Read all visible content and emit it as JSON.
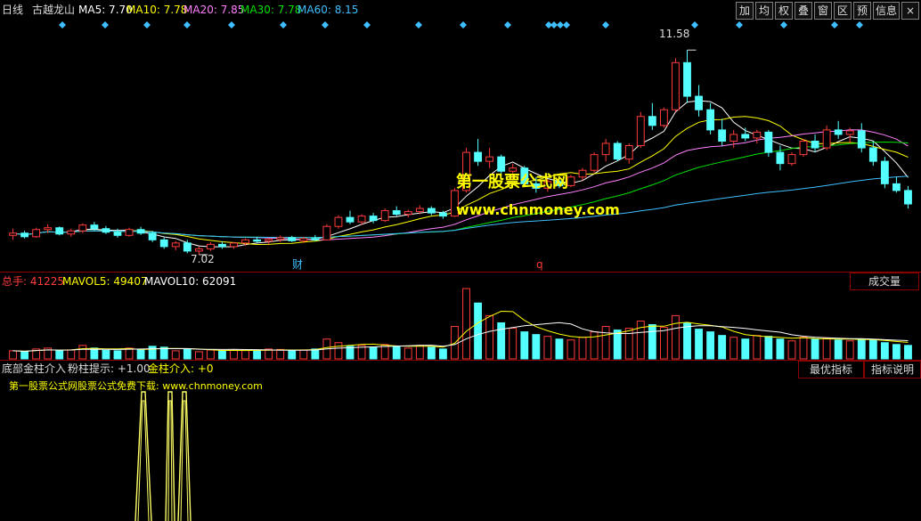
{
  "header": {
    "period": "日线",
    "stock_name": "古越龙山",
    "ma5": "MA5: 7.70",
    "ma10": "MA10: 7.78",
    "ma20": "MA20: 7.85",
    "ma30": "MA30: 7.78",
    "ma60": "MA60: 8.15"
  },
  "toolbar": {
    "buttons": [
      "加",
      "均",
      "权",
      "叠",
      "窗",
      "区",
      "预",
      "信息"
    ],
    "close": "×"
  },
  "main_chart": {
    "watermark_cn": "第一股票公式网",
    "watermark_url": "www.chnmoney.com",
    "high_label": "11.58",
    "low_label": "7.02",
    "marker_cai": "财",
    "marker_q": "q"
  },
  "volume_panel": {
    "total": "总手: 41225",
    "mavol5": "MAVOL5: 49407",
    "mavol10": "MAVOL10: 62091",
    "tab": "成交量"
  },
  "indicator_panel": {
    "title": "底部金柱介入",
    "hint": "粉柱提示: +1.00",
    "gold": "金柱介入: +0",
    "download": "第一股票公式网股票公式免费下载: www.chnmoney.com",
    "tab_best": "最优指标",
    "tab_help": "指标说明"
  },
  "colors": {
    "up": "#ff3b3b",
    "down": "#54ffff",
    "ma5": "#ffffff",
    "ma10": "#ffff00",
    "ma20": "#ff80ff",
    "ma30": "#00e000",
    "ma60": "#3fbfff",
    "grid_line": "#8b0000",
    "signal": "#ffff66"
  },
  "chart_data": {
    "type": "candlestick",
    "price_range": [
      6.9,
      12.1
    ],
    "high": 11.58,
    "low": 7.02,
    "candles": [
      [
        7.45,
        7.6,
        7.35,
        7.5
      ],
      [
        7.5,
        7.55,
        7.38,
        7.42
      ],
      [
        7.42,
        7.62,
        7.4,
        7.58
      ],
      [
        7.58,
        7.7,
        7.5,
        7.62
      ],
      [
        7.62,
        7.65,
        7.45,
        7.48
      ],
      [
        7.48,
        7.6,
        7.42,
        7.55
      ],
      [
        7.55,
        7.72,
        7.5,
        7.68
      ],
      [
        7.68,
        7.75,
        7.55,
        7.6
      ],
      [
        7.6,
        7.66,
        7.48,
        7.52
      ],
      [
        7.52,
        7.6,
        7.4,
        7.45
      ],
      [
        7.45,
        7.62,
        7.42,
        7.58
      ],
      [
        7.58,
        7.64,
        7.46,
        7.5
      ],
      [
        7.5,
        7.55,
        7.3,
        7.35
      ],
      [
        7.35,
        7.4,
        7.15,
        7.2
      ],
      [
        7.2,
        7.32,
        7.12,
        7.28
      ],
      [
        7.28,
        7.35,
        7.05,
        7.1
      ],
      [
        7.1,
        7.2,
        7.02,
        7.15
      ],
      [
        7.15,
        7.3,
        7.1,
        7.25
      ],
      [
        7.25,
        7.32,
        7.15,
        7.2
      ],
      [
        7.2,
        7.3,
        7.15,
        7.28
      ],
      [
        7.28,
        7.38,
        7.22,
        7.35
      ],
      [
        7.35,
        7.42,
        7.28,
        7.32
      ],
      [
        7.32,
        7.4,
        7.25,
        7.36
      ],
      [
        7.36,
        7.45,
        7.3,
        7.4
      ],
      [
        7.4,
        7.44,
        7.3,
        7.33
      ],
      [
        7.33,
        7.42,
        7.28,
        7.38
      ],
      [
        7.38,
        7.46,
        7.32,
        7.35
      ],
      [
        7.35,
        7.7,
        7.34,
        7.65
      ],
      [
        7.65,
        7.9,
        7.6,
        7.85
      ],
      [
        7.85,
        8.0,
        7.7,
        7.75
      ],
      [
        7.75,
        7.92,
        7.68,
        7.88
      ],
      [
        7.88,
        7.95,
        7.72,
        7.78
      ],
      [
        7.78,
        8.05,
        7.75,
        8.0
      ],
      [
        8.0,
        8.1,
        7.88,
        7.92
      ],
      [
        7.92,
        8.02,
        7.85,
        7.98
      ],
      [
        7.98,
        8.12,
        7.92,
        8.05
      ],
      [
        8.05,
        8.1,
        7.9,
        7.95
      ],
      [
        7.95,
        8.0,
        7.82,
        7.88
      ],
      [
        7.88,
        8.5,
        7.86,
        8.45
      ],
      [
        8.45,
        9.4,
        8.4,
        9.3
      ],
      [
        9.3,
        9.6,
        9.0,
        9.1
      ],
      [
        9.1,
        9.4,
        8.95,
        9.2
      ],
      [
        9.2,
        9.25,
        8.8,
        8.88
      ],
      [
        8.88,
        9.05,
        8.7,
        8.95
      ],
      [
        8.95,
        9.0,
        8.55,
        8.6
      ],
      [
        8.6,
        8.75,
        8.4,
        8.5
      ],
      [
        8.5,
        8.7,
        8.42,
        8.65
      ],
      [
        8.65,
        8.72,
        8.5,
        8.56
      ],
      [
        8.56,
        8.8,
        8.52,
        8.75
      ],
      [
        8.75,
        8.95,
        8.68,
        8.9
      ],
      [
        8.9,
        9.3,
        8.85,
        9.25
      ],
      [
        9.25,
        9.6,
        9.1,
        9.5
      ],
      [
        9.5,
        9.55,
        9.1,
        9.15
      ],
      [
        9.15,
        9.5,
        9.05,
        9.45
      ],
      [
        9.45,
        10.2,
        9.4,
        10.1
      ],
      [
        10.1,
        10.4,
        9.8,
        9.9
      ],
      [
        9.9,
        10.3,
        9.85,
        10.25
      ],
      [
        10.25,
        11.4,
        10.2,
        11.3
      ],
      [
        11.3,
        11.58,
        10.4,
        10.55
      ],
      [
        10.55,
        10.8,
        10.1,
        10.25
      ],
      [
        10.25,
        10.4,
        9.7,
        9.8
      ],
      [
        9.8,
        10.05,
        9.45,
        9.55
      ],
      [
        9.55,
        9.8,
        9.4,
        9.7
      ],
      [
        9.7,
        9.85,
        9.55,
        9.62
      ],
      [
        9.62,
        9.8,
        9.5,
        9.75
      ],
      [
        9.75,
        9.8,
        9.2,
        9.3
      ],
      [
        9.3,
        9.45,
        8.9,
        9.05
      ],
      [
        9.05,
        9.3,
        9.0,
        9.25
      ],
      [
        9.25,
        9.6,
        9.2,
        9.55
      ],
      [
        9.55,
        9.7,
        9.3,
        9.4
      ],
      [
        9.4,
        9.9,
        9.35,
        9.8
      ],
      [
        9.8,
        10.0,
        9.6,
        9.7
      ],
      [
        9.7,
        9.85,
        9.5,
        9.78
      ],
      [
        9.78,
        9.95,
        9.3,
        9.4
      ],
      [
        9.4,
        9.55,
        9.0,
        9.1
      ],
      [
        9.1,
        9.2,
        8.5,
        8.6
      ],
      [
        8.6,
        8.75,
        8.4,
        8.45
      ],
      [
        8.45,
        8.55,
        8.05,
        8.15
      ]
    ],
    "volume_range": [
      0,
      80000
    ],
    "volumes": [
      9000,
      8000,
      11000,
      12000,
      9000,
      10000,
      15000,
      12000,
      9500,
      9000,
      12000,
      10000,
      14000,
      13000,
      9000,
      11000,
      8000,
      10000,
      9000,
      9500,
      10000,
      9000,
      11000,
      10500,
      9000,
      10000,
      11000,
      22000,
      18000,
      14000,
      15000,
      13000,
      16000,
      14000,
      12000,
      15000,
      13000,
      11000,
      36000,
      78000,
      62000,
      48000,
      40000,
      34000,
      30000,
      27000,
      25000,
      22000,
      21000,
      24000,
      30000,
      36000,
      32000,
      34000,
      42000,
      38000,
      35000,
      48000,
      40000,
      33000,
      30000,
      26000,
      24000,
      22000,
      26000,
      25000,
      22000,
      20000,
      24000,
      22000,
      23000,
      21000,
      20000,
      22000,
      21000,
      18000,
      16000,
      15000
    ]
  }
}
